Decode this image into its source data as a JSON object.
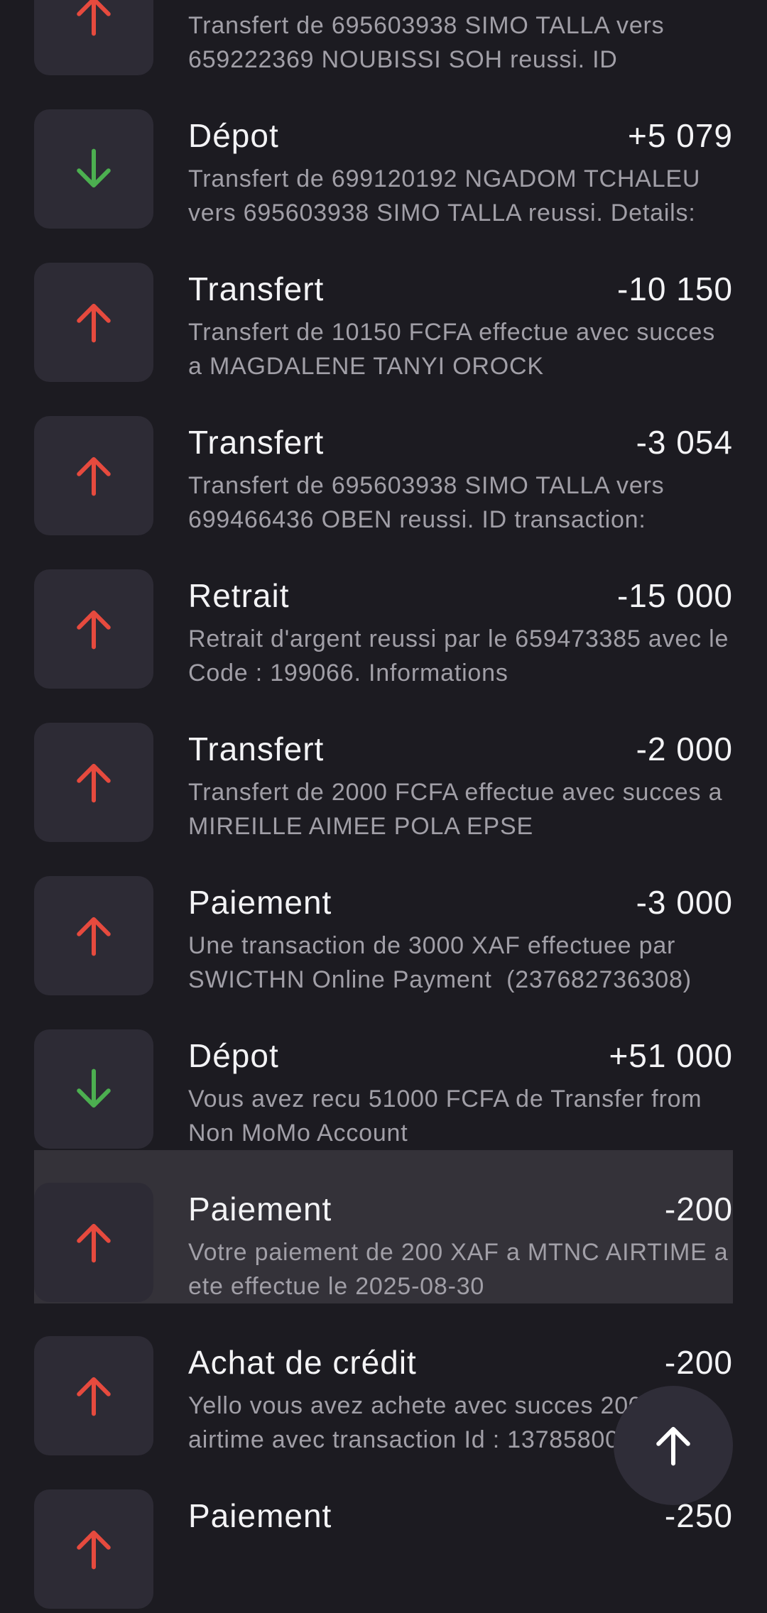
{
  "colors": {
    "background": "#1c1b21",
    "icon_bg": "#2d2b35",
    "up_arrow": "#e64a3e",
    "down_arrow": "#4caf50",
    "title_text": "#f3f3f5",
    "desc_text": "#a19fa7",
    "highlight_bg": "#343239"
  },
  "transactions": [
    {
      "direction": "out",
      "icon": "arrow-up-icon",
      "title": "",
      "amount": "",
      "description": "Transfert de 695603938 SIMO TALLA vers 659222369 NOUBISSI SOH reussi. ID",
      "highlighted": false
    },
    {
      "direction": "in",
      "icon": "arrow-down-icon",
      "title": "Dépot",
      "amount": "+5 079",
      "description": "Transfert de 699120192 NGADOM TCHALEU vers 695603938 SIMO TALLA reussi. Details:",
      "highlighted": false
    },
    {
      "direction": "out",
      "icon": "arrow-up-icon",
      "title": "Transfert",
      "amount": "-10 150",
      "description": "Transfert de 10150 FCFA effectue avec succes a MAGDALENE TANYI OROCK",
      "highlighted": false
    },
    {
      "direction": "out",
      "icon": "arrow-up-icon",
      "title": "Transfert",
      "amount": "-3 054",
      "description": "Transfert de 695603938 SIMO TALLA vers 699466436 OBEN reussi. ID transaction:",
      "highlighted": false
    },
    {
      "direction": "out",
      "icon": "arrow-up-icon",
      "title": "Retrait",
      "amount": "-15 000",
      "description": "Retrait d'argent reussi par le 659473385 avec le Code : 199066. Informations",
      "highlighted": false
    },
    {
      "direction": "out",
      "icon": "arrow-up-icon",
      "title": "Transfert",
      "amount": "-2 000",
      "description": "Transfert de 2000 FCFA effectue avec succes a MIREILLE AIMEE POLA EPSE",
      "highlighted": false
    },
    {
      "direction": "out",
      "icon": "arrow-up-icon",
      "title": "Paiement",
      "amount": "-3 000",
      "description": "Une transaction de 3000 XAF effectuee par SWICTHN Online Payment  (237682736308)",
      "highlighted": false
    },
    {
      "direction": "in",
      "icon": "arrow-down-icon",
      "title": "Dépot",
      "amount": "+51 000",
      "description": "Vous avez recu 51000 FCFA de Transfer from Non MoMo Account",
      "highlighted": false
    },
    {
      "direction": "out",
      "icon": "arrow-up-icon",
      "title": "Paiement",
      "amount": "-200",
      "description": "Votre paiement de 200 XAF a MTNC AIRTIME a ete effectue le 2025-08-30",
      "highlighted": true
    },
    {
      "direction": "out",
      "icon": "arrow-up-icon",
      "title": "Achat de crédit",
      "amount": "-200",
      "description": "Yello vous avez achete avec succes 200 XAF airtime avec transaction Id : 13785800",
      "highlighted": false
    },
    {
      "direction": "out",
      "icon": "arrow-up-icon",
      "title": "Paiement",
      "amount": "-250",
      "description": "",
      "highlighted": false
    }
  ],
  "scroll_top_button": {
    "icon": "arrow-up-icon"
  }
}
